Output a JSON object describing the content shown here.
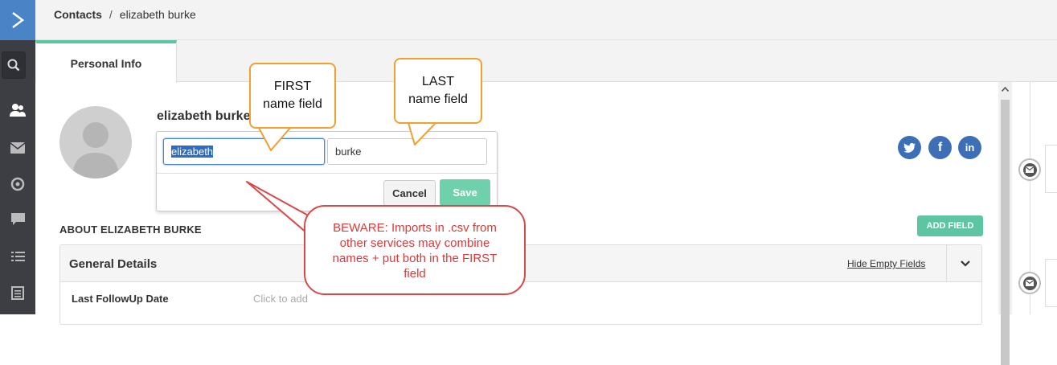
{
  "breadcrumb": {
    "root": "Contacts",
    "separator": "/",
    "current": "elizabeth burke"
  },
  "tabs": [
    {
      "label": "Personal Info",
      "active": true
    }
  ],
  "contact": {
    "name": "elizabeth burke"
  },
  "edit_form": {
    "first_name": "elizabeth",
    "last_name": "burke",
    "cancel_label": "Cancel",
    "save_label": "Save"
  },
  "social": [
    {
      "name": "twitter",
      "glyph": "t"
    },
    {
      "name": "facebook",
      "glyph": "f"
    },
    {
      "name": "linkedin",
      "glyph": "in"
    }
  ],
  "about": {
    "title": "ABOUT ELIZABETH BURKE",
    "add_field_label": "ADD FIELD"
  },
  "section": {
    "title": "General Details",
    "hide_empty_label": "Hide Empty Fields",
    "fields": [
      {
        "label": "Last FollowUp Date",
        "value": "Click to add"
      }
    ]
  },
  "annotations": {
    "first": "FIRST name field",
    "first_line1": "FIRST",
    "first_line2": "name field",
    "last_line1": "LAST",
    "last_line2": "name field",
    "beware": "BEWARE: Imports in .csv from other services may combine names + put both in the FIRST field"
  },
  "colors": {
    "accent_green": "#5ec5a3",
    "brand_blue": "#4a84c7",
    "nav_dark": "#3c3e44",
    "callout_orange": "#f0a030",
    "callout_red": "#d94848",
    "social_blue": "#3d6fb6"
  },
  "icons": [
    "logo-chevron-icon",
    "search-icon",
    "contacts-icon",
    "mail-icon",
    "target-icon",
    "chat-icon",
    "list-icon",
    "report-icon",
    "chevron-down-icon",
    "mail-timeline-icon"
  ]
}
